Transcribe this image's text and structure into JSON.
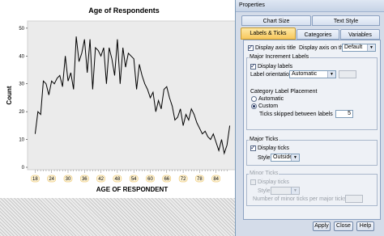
{
  "chart_data": {
    "type": "line",
    "title": "Age of Respondents",
    "xlabel": "AGE OF RESPONDENT",
    "ylabel": "Count",
    "x": [
      18,
      19,
      20,
      21,
      22,
      23,
      24,
      25,
      26,
      27,
      28,
      29,
      30,
      31,
      32,
      33,
      34,
      35,
      36,
      37,
      38,
      39,
      40,
      41,
      42,
      43,
      44,
      45,
      46,
      47,
      48,
      49,
      50,
      51,
      52,
      53,
      54,
      55,
      56,
      57,
      58,
      59,
      60,
      61,
      62,
      63,
      64,
      65,
      66,
      67,
      68,
      69,
      70,
      71,
      72,
      73,
      74,
      75,
      76,
      77,
      78,
      79,
      80,
      81,
      82,
      83,
      84,
      85,
      86,
      87,
      88,
      89
    ],
    "y": [
      12,
      20,
      19,
      31,
      30,
      26,
      31,
      30,
      32,
      33,
      29,
      40,
      31,
      34,
      28,
      47,
      38,
      41,
      46,
      34,
      46,
      28,
      43,
      42,
      40,
      43,
      30,
      43,
      39,
      33,
      46,
      30,
      43,
      36,
      41,
      40,
      39,
      28,
      37,
      33,
      30,
      28,
      25,
      27,
      20,
      24,
      21,
      28,
      29,
      25,
      22,
      17,
      18,
      21,
      15,
      19,
      17,
      21,
      19,
      16,
      14,
      12,
      13,
      11,
      10,
      12,
      9,
      6,
      10,
      5,
      8,
      15
    ],
    "xticks": [
      18,
      24,
      30,
      36,
      42,
      48,
      54,
      60,
      66,
      72,
      78,
      84
    ],
    "yticks": [
      0,
      10,
      20,
      30,
      40,
      50
    ],
    "xlim": [
      17,
      90
    ],
    "ylim": [
      0,
      52
    ]
  },
  "dialog": {
    "title": "Properties",
    "tabs_row1": [
      "Chart Size",
      "Text Style"
    ],
    "tabs_row2": [
      "Labels & Ticks",
      "Categories",
      "Variables"
    ],
    "display_axis_title": "Display axis title",
    "display_axis_on": "Display axis on the:",
    "axis_side": "Default",
    "major_inc_group": "Major Increment Labels",
    "display_labels": "Display labels",
    "label_orientation": "Label orientation",
    "orientation_value": "Automatic",
    "cat_placement": "Category Label Placement",
    "automatic": "Automatic",
    "custom": "Custom",
    "ticks_skipped": "Ticks skipped between labels",
    "ticks_skipped_value": "5",
    "major_ticks_group": "Major Ticks",
    "display_ticks": "Display ticks",
    "style_label": "Style",
    "style_value": "Outside",
    "minor_ticks_group": "Minor Ticks",
    "minor_display_ticks": "Display ticks",
    "minor_style": "Style",
    "minor_per_major": "Number of minor ticks per major ticks",
    "apply": "Apply",
    "close": "Close",
    "help": "Help"
  }
}
